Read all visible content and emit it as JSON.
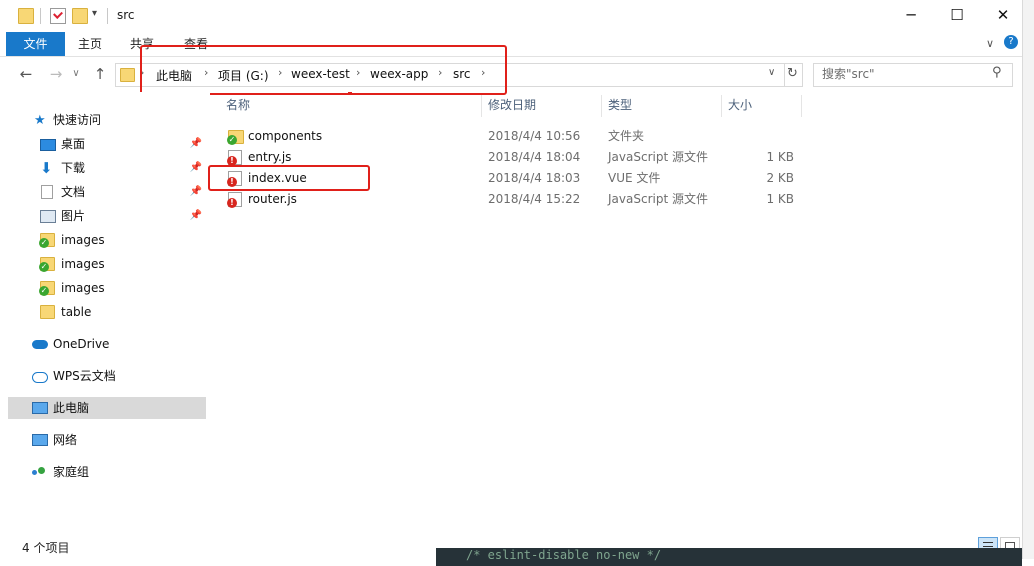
{
  "window": {
    "title": "src",
    "controls": {
      "minimize": "─",
      "maximize": "☐",
      "close": "✕"
    }
  },
  "ribbon": {
    "tabs": [
      "文件",
      "主页",
      "共享",
      "查看"
    ],
    "collapse_icon": "∨",
    "help_icon": "?"
  },
  "address": {
    "back": "←",
    "forward": "→",
    "recent": "∨",
    "up": "↑",
    "breadcrumbs": [
      "此电脑",
      "项目 (G:)",
      "weex-test",
      "weex-app",
      "src"
    ],
    "separator": "›",
    "dropdown": "∨",
    "refresh": "↻"
  },
  "search": {
    "placeholder": "搜索\"src\"",
    "icon": "⚲"
  },
  "sidebar": {
    "items": [
      {
        "label": "快速访问",
        "icon": "star-icon",
        "pinned": false
      },
      {
        "label": "桌面",
        "icon": "desktop-icon",
        "pinned": true
      },
      {
        "label": "下载",
        "icon": "download-icon",
        "pinned": true
      },
      {
        "label": "文档",
        "icon": "document-icon",
        "pinned": true
      },
      {
        "label": "图片",
        "icon": "pictures-icon",
        "pinned": true
      },
      {
        "label": "images",
        "icon": "synced-folder-icon",
        "pinned": false
      },
      {
        "label": "images",
        "icon": "synced-folder-icon",
        "pinned": false
      },
      {
        "label": "images",
        "icon": "synced-folder-icon",
        "pinned": false
      },
      {
        "label": "table",
        "icon": "folder-icon",
        "pinned": false
      },
      {
        "label": "OneDrive",
        "icon": "cloud-icon",
        "pinned": false
      },
      {
        "label": "WPS云文档",
        "icon": "cloud-outline-icon",
        "pinned": false
      },
      {
        "label": "此电脑",
        "icon": "computer-icon",
        "pinned": false,
        "selected": true
      },
      {
        "label": "网络",
        "icon": "network-icon",
        "pinned": false
      },
      {
        "label": "家庭组",
        "icon": "homegroup-icon",
        "pinned": false
      }
    ],
    "pin_glyph": "📌"
  },
  "columns": [
    "名称",
    "修改日期",
    "类型",
    "大小"
  ],
  "files": [
    {
      "name": "components",
      "date": "2018/4/4 10:56",
      "type": "文件夹",
      "size": "",
      "icon": "folder-synced-icon"
    },
    {
      "name": "entry.js",
      "date": "2018/4/4 18:04",
      "type": "JavaScript 源文件",
      "size": "1 KB",
      "icon": "file-conflict-icon"
    },
    {
      "name": "index.vue",
      "date": "2018/4/4 18:03",
      "type": "VUE 文件",
      "size": "2 KB",
      "icon": "file-conflict-icon"
    },
    {
      "name": "router.js",
      "date": "2018/4/4 15:22",
      "type": "JavaScript 源文件",
      "size": "1 KB",
      "icon": "file-conflict-icon"
    }
  ],
  "badges": {
    "error": "!",
    "ok": "✓"
  },
  "status": {
    "item_count": "4 个项目"
  },
  "background_editor": {
    "text": "/* eslint-disable no-new */"
  },
  "colors": {
    "accent": "#1979ca",
    "annotation_red": "#e0201a",
    "folder": "#f8d775"
  }
}
